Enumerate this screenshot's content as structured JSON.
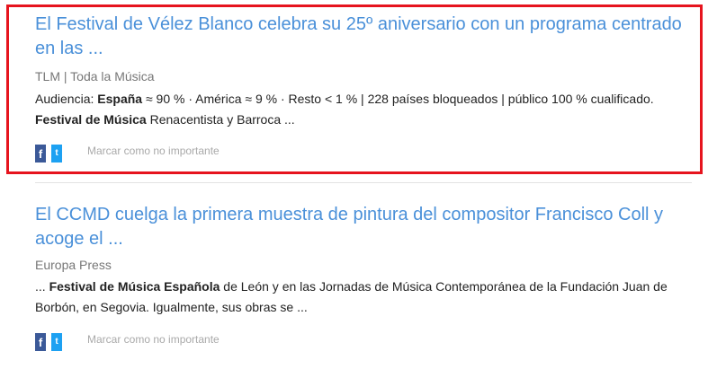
{
  "articles": [
    {
      "title": "El Festival de Vélez Blanco celebra su 25º aniversario con un programa centrado en las ...",
      "source": "TLM | Toda la Música",
      "snippet": [
        {
          "text": "Audiencia: ",
          "bold": false
        },
        {
          "text": "España",
          "bold": true
        },
        {
          "text": " ≈ 90 % · América ≈ 9 % · Resto < 1 % | 228 países bloqueados | público 100 % cualificado. ",
          "bold": false
        },
        {
          "text": "Festival de Música",
          "bold": true
        },
        {
          "text": " Renacentista y Barroca ...",
          "bold": false
        }
      ],
      "highlighted": true,
      "mark_label": "Marcar como no importante",
      "facebook_icon": "facebook-icon",
      "twitter_icon": "twitter-icon"
    },
    {
      "title": "El CCMD cuelga la primera muestra de pintura del compositor Francisco Coll y acoge el ...",
      "source": "Europa Press",
      "snippet": [
        {
          "text": "... ",
          "bold": false
        },
        {
          "text": "Festival de Música Española",
          "bold": true
        },
        {
          "text": " de León y en las Jornadas de Música Contemporánea de la Fundación Juan de Borbón, en Segovia. Igualmente, sus obras se ...",
          "bold": false
        }
      ],
      "highlighted": false,
      "mark_label": "Marcar como no importante",
      "facebook_icon": "facebook-icon",
      "twitter_icon": "twitter-icon"
    }
  ],
  "colors": {
    "title": "#4a90d9",
    "highlight_border": "#e6141e",
    "source": "#777777",
    "mark": "#a9a9a9",
    "facebook": "#3b5998",
    "twitter": "#1da1f2"
  }
}
